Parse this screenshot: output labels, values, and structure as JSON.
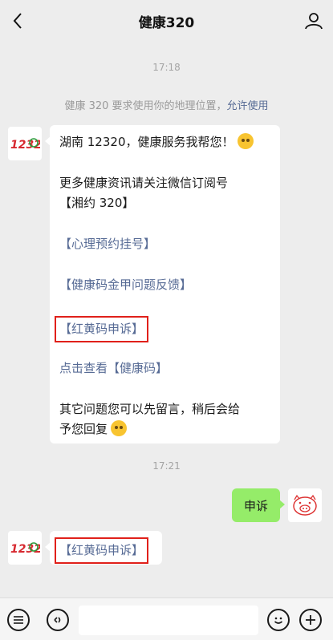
{
  "header": {
    "title": "健康320"
  },
  "timestamps": [
    "17:18",
    "17:21"
  ],
  "system_notice": {
    "text": "健康 320 要求使用你的地理位置，",
    "action": "允许使用"
  },
  "bot": {
    "avatar_text": "12320"
  },
  "welcome_message": {
    "line1": "湖南 12320，健康服务我帮您！",
    "line2": "更多健康资讯请关注微信订阅号",
    "line3": "【湘约 320】",
    "link1": "【心理预约挂号】",
    "link2": "【健康码金甲问题反馈】",
    "link3": "【红黄码申诉】",
    "link4_prefix": "点击查看",
    "link4": "【健康码】",
    "line_last1": "其它问题您可以先留言，稍后会给",
    "line_last2": "予您回复"
  },
  "user_message": {
    "text": "申诉"
  },
  "bot_reply": {
    "text": "【红黄码申诉】"
  }
}
